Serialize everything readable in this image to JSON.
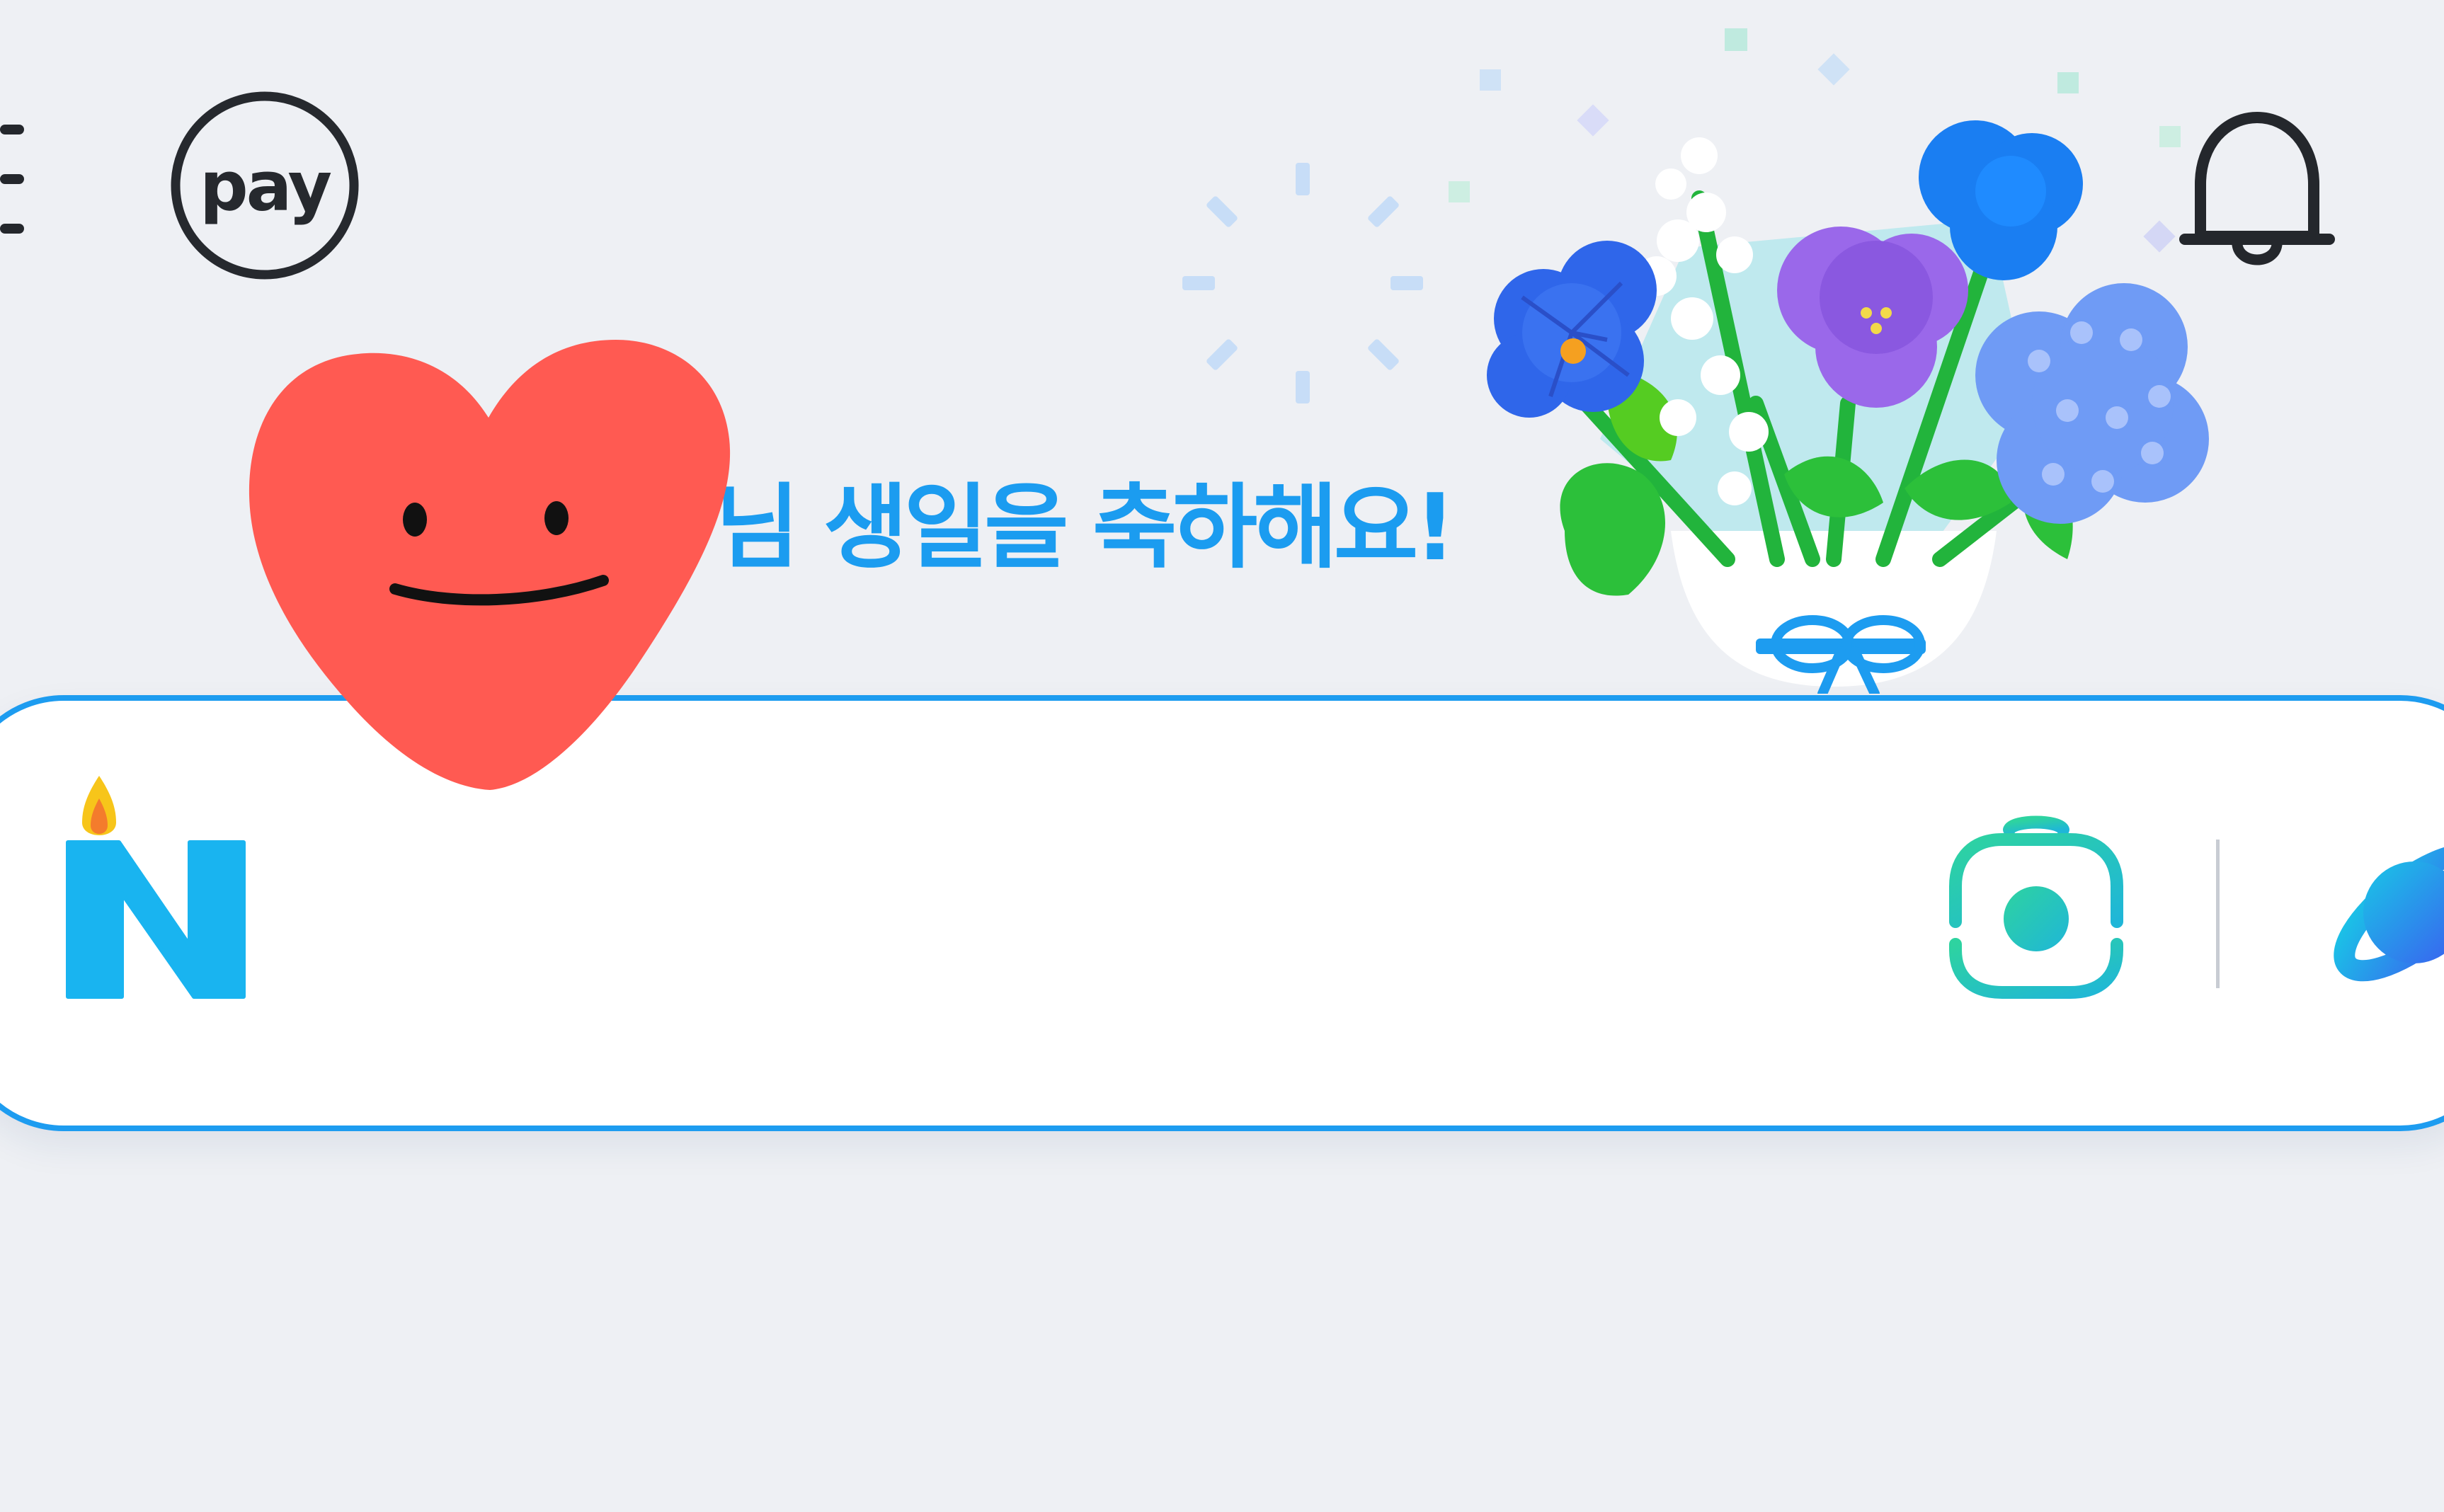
{
  "header": {
    "menu_icon": "hamburger-menu-icon",
    "pay_label": "pay",
    "bell_icon": "notification-bell-icon"
  },
  "banner": {
    "greeting": "님 생일을 축하해요!",
    "illustration": "birthday-flower-bouquet",
    "sticker": "smiling-heart-sticker"
  },
  "search": {
    "value": "",
    "placeholder": "",
    "logo_icon": "naver-birthday-candle-logo-icon",
    "lens_icon": "camera-lens-search-icon",
    "ai_icon": "ai-planet-icon"
  },
  "colors": {
    "background": "#eef0f4",
    "accent": "#1d9cf0",
    "greeting_text": "#1b9cf0",
    "lens_green": "#26c6a8",
    "heart_red": "#ff5a52"
  }
}
